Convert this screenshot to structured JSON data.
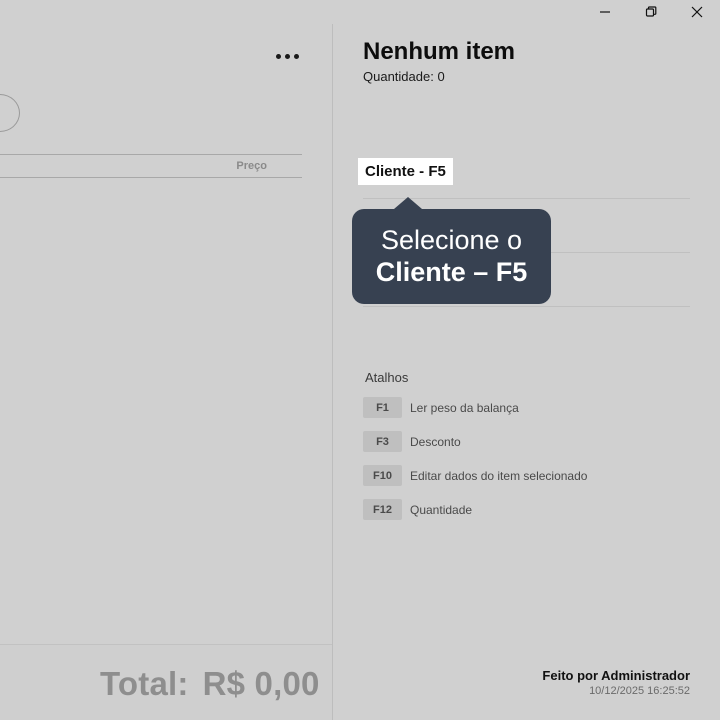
{
  "window": {
    "controls": [
      "minimize-icon",
      "restore-icon",
      "close-icon"
    ]
  },
  "left": {
    "more_icon": "more-horizontal-icon",
    "table": {
      "columns": [
        "Preço"
      ]
    },
    "footer": {
      "total_label": "Total:",
      "total_value": "R$ 0,00"
    }
  },
  "right": {
    "title": "Nenhum item",
    "quantity_label": "Quantidade:",
    "quantity_value": "0",
    "client_button": "Cliente - F5",
    "tooltip": {
      "line1": "Selecione o",
      "line2": "Cliente – F5"
    },
    "shortcuts": {
      "title": "Atalhos",
      "items": [
        {
          "key": "F1",
          "label": "Ler peso da balança"
        },
        {
          "key": "F3",
          "label": "Desconto"
        },
        {
          "key": "F10",
          "label": "Editar dados do item selecionado"
        },
        {
          "key": "F12",
          "label": "Quantidade"
        }
      ]
    },
    "made_by": "Feito por Administrador",
    "timestamp": "10/12/2025 16:25:52"
  },
  "colors": {
    "background": "#d0d0d0",
    "tooltip": "#374151",
    "client_button": "#ffffff",
    "shortcut_key": "#bfbfbf"
  }
}
